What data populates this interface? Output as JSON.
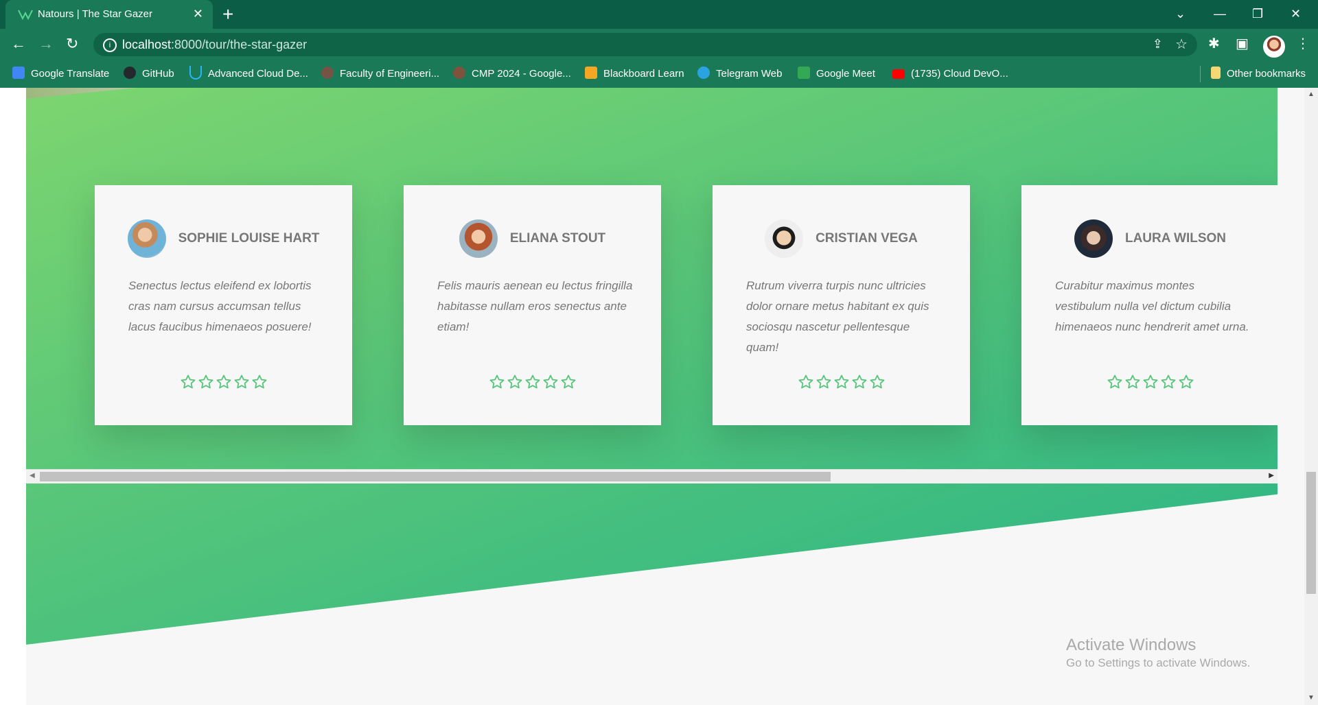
{
  "browser": {
    "tab_title": "Natours | The Star Gazer",
    "url_host": "localhost",
    "url_path": ":8000/tour/the-star-gazer",
    "new_tab": "+",
    "close_tab": "✕"
  },
  "bookmarks": [
    {
      "label": "Google Translate",
      "icon": "google-translate-icon",
      "color": "#4285f4"
    },
    {
      "label": "GitHub",
      "icon": "github-icon",
      "color": "#24292e"
    },
    {
      "label": "Advanced Cloud De...",
      "icon": "udemy-icon",
      "color": "#29b6f6"
    },
    {
      "label": "Faculty of Engineeri...",
      "icon": "faculty-icon",
      "color": "#b33a3a"
    },
    {
      "label": "CMP 2024 - Google...",
      "icon": "google-groups-icon",
      "color": "#c0392b"
    },
    {
      "label": "Blackboard Learn",
      "icon": "blackboard-icon",
      "color": "#f5a623"
    },
    {
      "label": "Telegram Web",
      "icon": "telegram-icon",
      "color": "#2aa3e0"
    },
    {
      "label": "Google Meet",
      "icon": "google-meet-icon",
      "color": "#34a853"
    },
    {
      "label": "(1735) Cloud DevO...",
      "icon": "youtube-icon",
      "color": "#ff0000"
    }
  ],
  "other_bookmarks": "Other bookmarks",
  "reviews": [
    {
      "name": "Sophie Louise Hart",
      "text": "Senectus lectus eleifend ex lobortis cras nam cursus accumsan tellus lacus faucibus himenaeos posuere!",
      "rating": 5
    },
    {
      "name": "Eliana Stout",
      "text": "Felis mauris aenean eu lectus fringilla habitasse nullam eros senectus ante etiam!",
      "rating": 5
    },
    {
      "name": "Cristian Vega",
      "text": "Rutrum viverra turpis nunc ultricies dolor ornare metus habitant ex quis sociosqu nascetur pellentesque quam!",
      "rating": 5
    },
    {
      "name": "Laura Wilson",
      "text": "Curabitur maximus montes vestibulum nulla vel dictum cubilia himenaeos nunc hendrerit amet urna.",
      "rating": 5
    }
  ],
  "colors": {
    "brand_green": "#55c57a",
    "star_color": "#55c57a",
    "card_bg": "#f7f7f7"
  },
  "watermark": {
    "title": "Activate Windows",
    "subtitle": "Go to Settings to activate Windows."
  }
}
